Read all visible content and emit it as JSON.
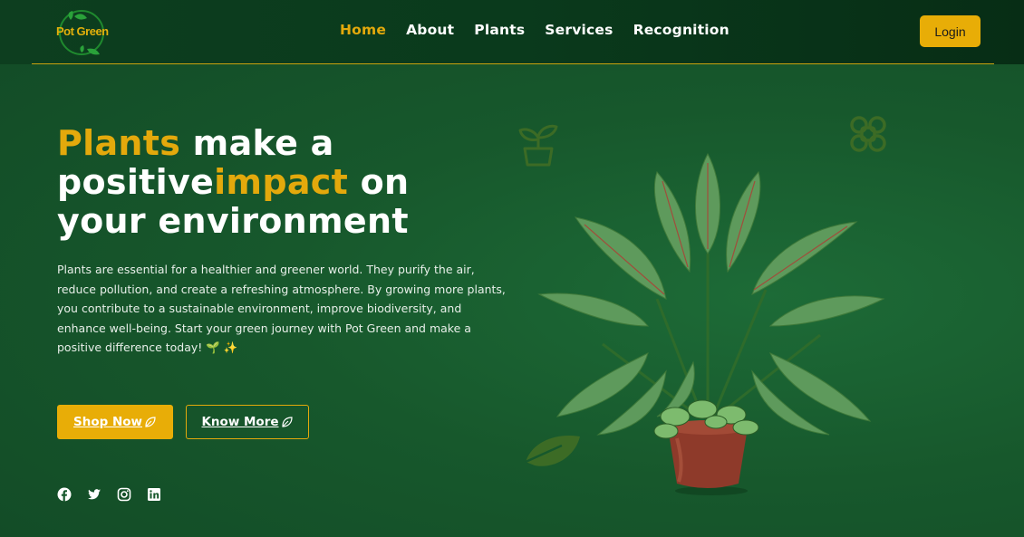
{
  "brand": {
    "logo_text": "Pot Green"
  },
  "nav": {
    "items": [
      {
        "label": "Home",
        "active": true
      },
      {
        "label": "About"
      },
      {
        "label": "Plants"
      },
      {
        "label": "Services"
      },
      {
        "label": "Recognition"
      }
    ],
    "login_label": "Login"
  },
  "hero": {
    "title_part1": "Plants",
    "title_part2": " make a positive",
    "title_part3": "impact",
    "title_part4": " on your environment",
    "description": "Plants are essential for a healthier and greener world. They purify the air, reduce pollution, and create a refreshing atmosphere. By growing more plants, you contribute to a sustainable environment, improve biodiversity, and enhance well-being. Start your green journey with Pot Green and make a positive difference today! 🌱 ✨",
    "shop_label": "Shop Now",
    "more_label": "Know More"
  },
  "socials": [
    "facebook-icon",
    "twitter-icon",
    "instagram-icon",
    "linkedin-icon"
  ],
  "colors": {
    "accent": "#e8ad07",
    "background": "#17582c",
    "header": "#0a3a1c"
  }
}
